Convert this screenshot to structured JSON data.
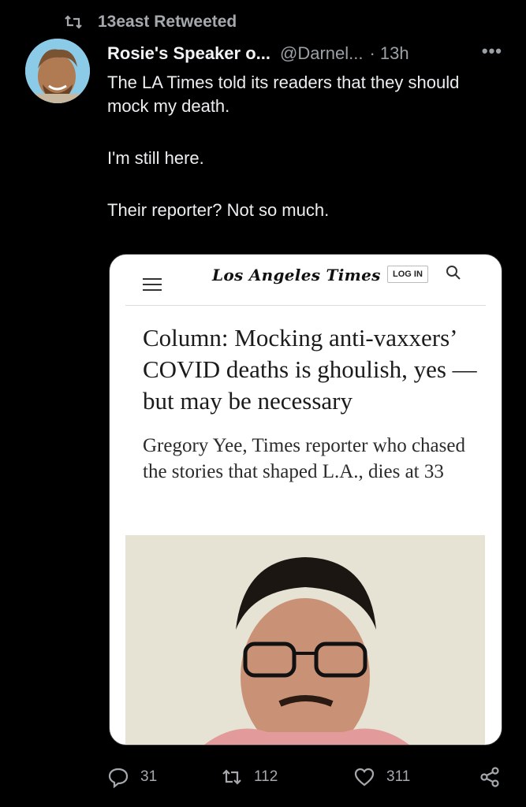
{
  "retweet": {
    "label": "13east Retweeted"
  },
  "tweet": {
    "display_name": "Rosie's Speaker o...",
    "handle": "@Darnel...",
    "time": "· 13h",
    "more": "•••",
    "paragraphs": [
      "The LA Times told its readers that they should mock my death.",
      "I'm still here.",
      "Their reporter? Not so much."
    ]
  },
  "card": {
    "logo": "Los Angeles Times",
    "login": "LOG IN",
    "headline": "Column: Mocking anti-vaxxers’ COVID deaths is ghoulish, yes — but may be necessary",
    "subhead": "Gregory Yee, Times reporter who chased the stories that shaped L.A., dies at 33"
  },
  "actions": {
    "replies": "31",
    "retweets": "112",
    "likes": "311"
  },
  "colors": {
    "background": "#000000",
    "text": "#e7e9ea",
    "muted": "#a5a9ad"
  }
}
